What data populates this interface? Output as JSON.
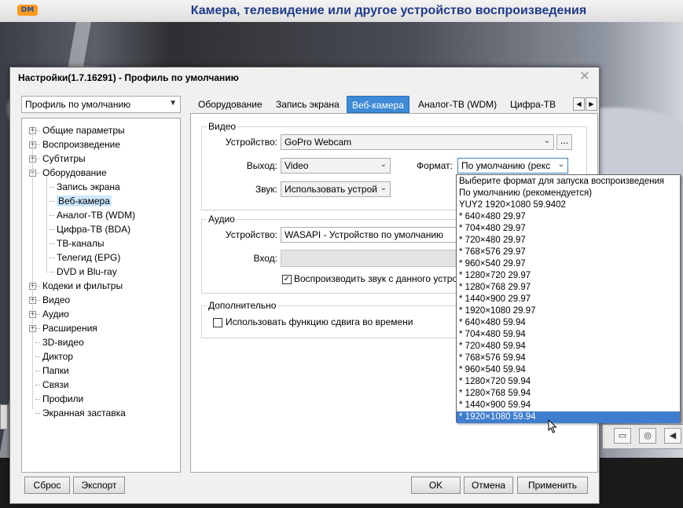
{
  "player": {
    "logo_text": "DM",
    "title": "Камера, телевидение или другое устройство воспроизведения"
  },
  "dialog": {
    "title": "Настройки(1.7.16291) - Профиль по умолчанию",
    "close_icon": "close-icon",
    "profile_combo": "Профиль по умолчанию",
    "tree": [
      {
        "label": "Общие параметры",
        "expanded": false,
        "level": 0
      },
      {
        "label": "Воспроизведение",
        "expanded": false,
        "level": 0
      },
      {
        "label": "Субтитры",
        "expanded": false,
        "level": 0
      },
      {
        "label": "Оборудование",
        "expanded": true,
        "level": 0
      },
      {
        "label": "Запись экрана",
        "level": 1
      },
      {
        "label": "Веб-камера",
        "level": 1,
        "selected": true
      },
      {
        "label": "Аналог-ТВ (WDM)",
        "level": 1
      },
      {
        "label": "Цифра-ТВ (BDA)",
        "level": 1
      },
      {
        "label": "ТВ-каналы",
        "level": 1
      },
      {
        "label": "Телегид (EPG)",
        "level": 1
      },
      {
        "label": "DVD и Blu-ray",
        "level": 1
      },
      {
        "label": "Кодеки и фильтры",
        "expanded": false,
        "level": 0
      },
      {
        "label": "Видео",
        "expanded": false,
        "level": 0
      },
      {
        "label": "Аудио",
        "expanded": false,
        "level": 0
      },
      {
        "label": "Расширения",
        "expanded": false,
        "level": 0
      },
      {
        "label": "3D-видео",
        "level": 0
      },
      {
        "label": "Диктор",
        "level": 0
      },
      {
        "label": "Папки",
        "level": 0
      },
      {
        "label": "Связи",
        "level": 0
      },
      {
        "label": "Профили",
        "level": 0
      },
      {
        "label": "Экранная заставка",
        "level": 0
      }
    ],
    "tabs": [
      "Оборудование",
      "Запись экрана",
      "Веб-камера",
      "Аналог-ТВ (WDM)",
      "Цифра-ТВ"
    ],
    "active_tab": "Веб-камера",
    "video": {
      "group_title": "Видео",
      "device_label": "Устройство:",
      "device_value": "GoPro Webcam",
      "browse_label": "...",
      "output_label": "Выход:",
      "output_value": "Video",
      "format_label": "Формат:",
      "format_value": "По умолчанию (рекс",
      "sound_label": "Звук:",
      "sound_value": "Использовать устрой"
    },
    "audio": {
      "group_title": "Аудио",
      "device_label": "Устройство:",
      "device_value": "WASAPI - Устройство по умолчанию",
      "input_label": "Вход:",
      "play_sound_label": "Воспроизводить звук с данного устро",
      "play_sound_checked": true
    },
    "extra": {
      "group_title": "Дополнительно",
      "timeshift_label": "Использовать функцию сдвига во времени",
      "timeshift_checked": false
    },
    "format_options": [
      "Выберите формат для запуска воспроизведения",
      "По умолчанию (рекомендуется)",
      "YUY2 1920×1080 59.9402",
      "* 640×480 29.97",
      "* 704×480 29.97",
      "* 720×480 29.97",
      "* 768×576 29.97",
      "* 960×540 29.97",
      "* 1280×720 29.97",
      "* 1280×768 29.97",
      "* 1440×900 29.97",
      "* 1920×1080 29.97",
      "* 640×480 59.94",
      "* 704×480 59.94",
      "* 720×480 59.94",
      "* 768×576 59.94",
      "* 960×540 59.94",
      "* 1280×720 59.94",
      "* 1280×768 59.94",
      "* 1440×900 59.94",
      "* 1920×1080 59.94"
    ],
    "format_selected": "* 1920×1080 59.94",
    "buttons": {
      "reset": "Сброс",
      "export": "Экспорт",
      "ok": "OK",
      "cancel": "Отмена",
      "apply": "Применить"
    }
  }
}
